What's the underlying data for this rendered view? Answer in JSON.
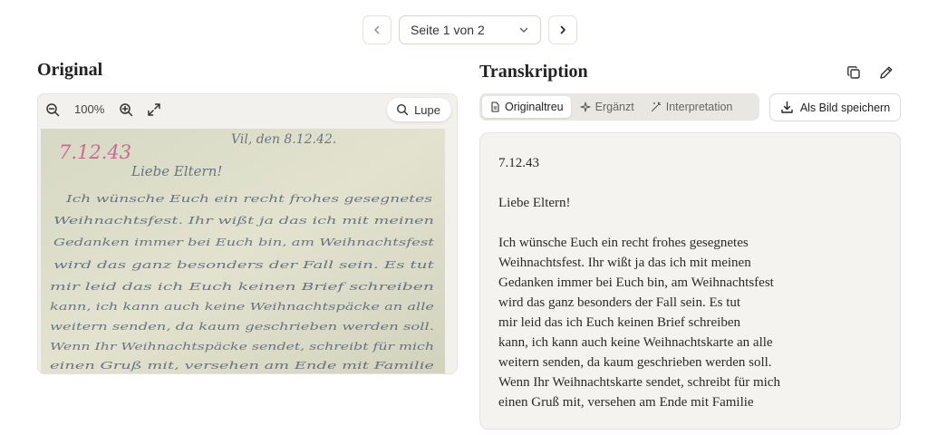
{
  "pager": {
    "page_label": "Seite 1 von 2"
  },
  "original": {
    "heading": "Original",
    "zoom": "100%",
    "lupe_label": "Lupe",
    "letter_lines": [
      "Vil, den 8.12.42.",
      "7.12.43",
      "Liebe Eltern!",
      "Ich wünsche Euch ein recht frohes gesegnetes",
      "Weihnachtsfest. Ihr wißt ja das ich mit meinen",
      "Gedanken immer bei Euch bin, am Weihnachtsfest",
      "wird das ganz besonders der Fall sein. Es tut",
      "mir leid das ich Euch keinen Brief schreiben",
      "kann, ich kann auch keine Weihnachtspäcke an alle",
      "weitern senden, da kaum geschrieben werden soll.",
      "Wenn Ihr Weihnachtspäcke sendet, schreibt für mich",
      "einen Gruß mit, versehen am Ende mit Familie"
    ]
  },
  "transcription": {
    "heading": "Transkription",
    "tabs": [
      "Originaltreu",
      "Ergänzt",
      "Interpretation"
    ],
    "save_label": "Als Bild speichern",
    "date": "7.12.43",
    "greeting": "Liebe Eltern!",
    "body_lines": [
      "Ich wünsche Euch ein recht frohes gesegnetes",
      "Weihnachtsfest. Ihr wißt ja das ich mit meinen",
      "Gedanken immer bei Euch bin, am Weihnachtsfest",
      "wird das ganz besonders der Fall sein. Es tut",
      "mir leid das ich Euch keinen Brief schreiben",
      "kann, ich kann auch keine Weihnachtskarte an alle",
      "weitern senden, da kaum geschrieben werden soll.",
      "Wenn Ihr Weihnachtskarte sendet, schreibt für mich",
      "einen Gruß mit, versehen am Ende mit Familie"
    ]
  },
  "colors": {
    "paper": "#dcdcc8",
    "ink": "#3c4c66",
    "red_pencil": "#c0427a"
  }
}
